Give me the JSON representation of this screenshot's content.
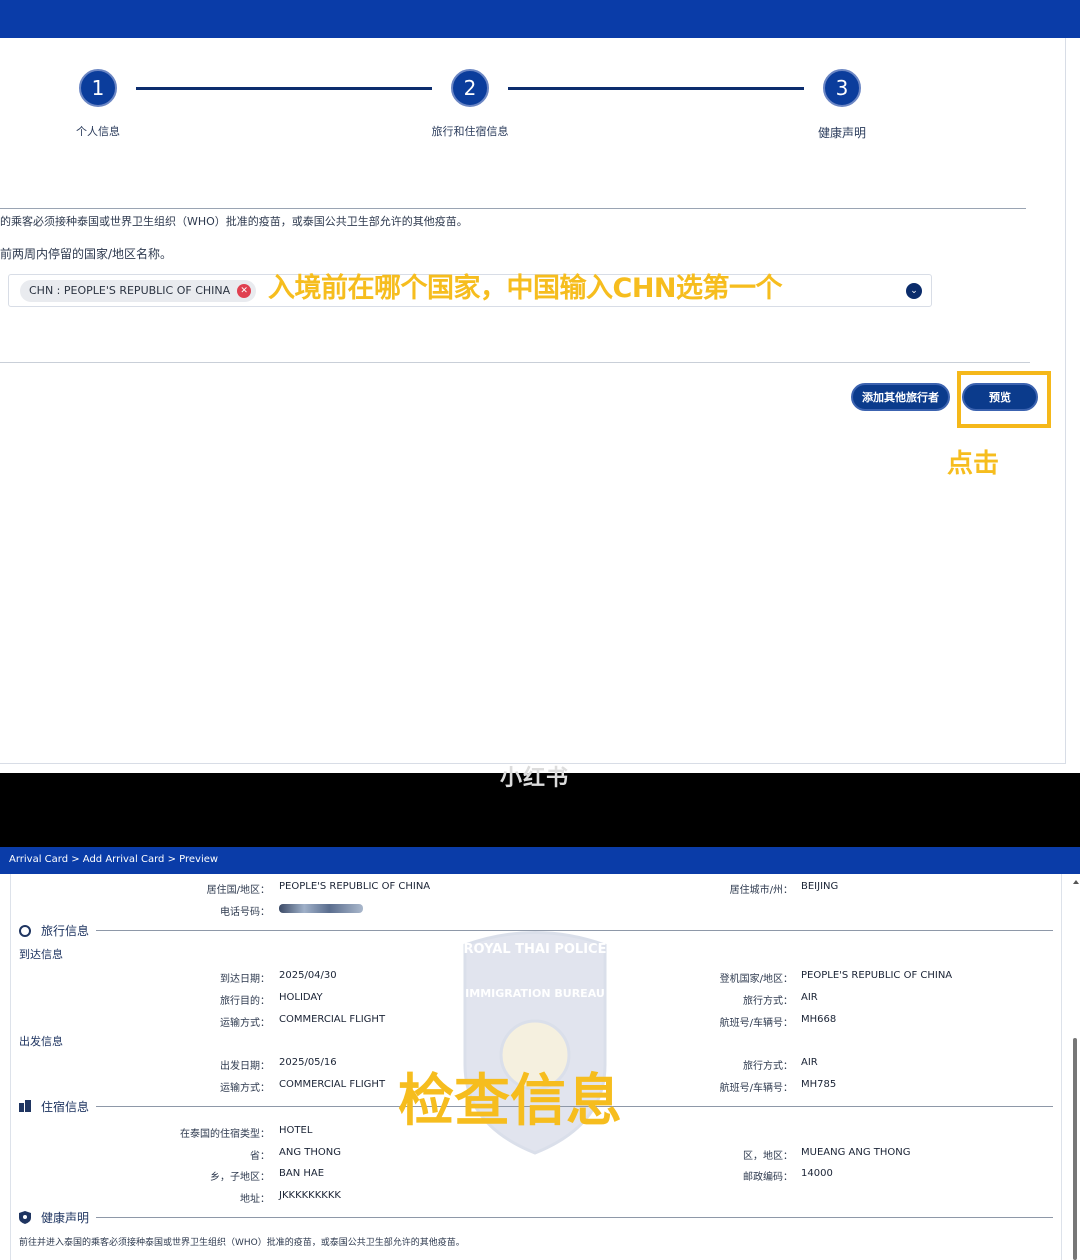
{
  "colors": {
    "brand_blue": "#0a3ca8",
    "step_blue": "#0b3d9c",
    "annotation_yellow": "#f6bd1e",
    "chip_remove_red": "#e04050"
  },
  "stepper": {
    "steps": [
      {
        "number": "1",
        "label": "个人信息"
      },
      {
        "number": "2",
        "label": "旅行和住宿信息"
      },
      {
        "number": "3",
        "label": "健康声明"
      }
    ]
  },
  "health_form": {
    "vaccine_notice": "的乘客必须接种泰国或世界卫生组织（WHO）批准的疫苗，或泰国公共卫生部允许的其他疫苗。",
    "countries_question": "前两周内停留的国家/地区名称。",
    "selected_country": "CHN : PEOPLE'S REPUBLIC OF CHINA",
    "chip_remove_icon": "✕",
    "dropdown_icon": "⌄"
  },
  "buttons": {
    "add_traveler": "添加其他旅行者",
    "preview": "预览"
  },
  "annotations": {
    "country_hint": "入境前在哪个国家，中国输入CHN选第一个",
    "click_hint": "点击",
    "check_hint": "检查信息"
  },
  "watermark": "小红书",
  "breadcrumb": "Arrival Card > Add Arrival Card > Preview",
  "preview": {
    "residence": {
      "country_label": "居住国/地区：",
      "country_value": "PEOPLE'S REPUBLIC OF CHINA",
      "city_label": "居住城市/州：",
      "city_value": "BEIJING",
      "phone_label": "电话号码："
    },
    "travel_section_title": "旅行信息",
    "arrival_title": "到达信息",
    "arrival": {
      "date_label": "到达日期：",
      "date_value": "2025/04/30",
      "purpose_label": "旅行目的：",
      "purpose_value": "HOLIDAY",
      "transport_label": "运输方式：",
      "transport_value": "COMMERCIAL FLIGHT",
      "board_country_label": "登机国家/地区：",
      "board_country_value": "PEOPLE'S REPUBLIC OF CHINA",
      "mode_label": "旅行方式：",
      "mode_value": "AIR",
      "flight_label": "航班号/车辆号：",
      "flight_value": "MH668"
    },
    "departure_title": "出发信息",
    "departure": {
      "date_label": "出发日期：",
      "date_value": "2025/05/16",
      "transport_label": "运输方式：",
      "transport_value": "COMMERCIAL FLIGHT",
      "mode_label": "旅行方式：",
      "mode_value": "AIR",
      "flight_label": "航班号/车辆号：",
      "flight_value": "MH785"
    },
    "accommodation_title": "住宿信息",
    "accommodation": {
      "type_label": "在泰国的住宿类型：",
      "type_value": "HOTEL",
      "province_label": "省：",
      "province_value": "ANG THONG",
      "subdistrict_label": "乡，子地区：",
      "subdistrict_value": "BAN HAE",
      "address_label": "地址：",
      "address_value": "JKKKKKKKKK",
      "district_label": "区，地区：",
      "district_value": "MUEANG ANG THONG",
      "postcode_label": "邮政编码：",
      "postcode_value": "14000"
    },
    "health_title": "健康声明",
    "health_notice": "前往并进入泰国的乘客必须接种泰国或世界卫生组织（WHO）批准的疫苗，或泰国公共卫生部允许的其他疫苗。",
    "seal_text_top": "ROYAL THAI POLICE",
    "seal_text_mid": "IMMIGRATION BUREAU"
  }
}
